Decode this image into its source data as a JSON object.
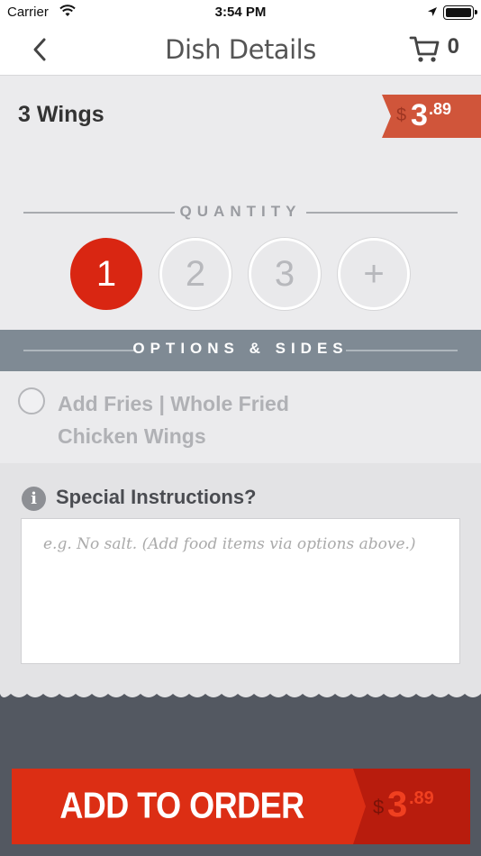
{
  "status_bar": {
    "carrier": "Carrier",
    "time": "3:54 PM"
  },
  "nav": {
    "title": "Dish Details",
    "cart_count": "0"
  },
  "dish": {
    "name": "3 Wings",
    "price_symbol": "$",
    "price_whole": "3",
    "price_cents": ".89"
  },
  "quantity": {
    "label": "QUANTITY",
    "options": [
      "1",
      "2",
      "3",
      "+"
    ],
    "selected": "1"
  },
  "options": {
    "label": "OPTIONS & SIDES",
    "items": [
      {
        "label": "Add Fries | Whole Fried Chicken Wings",
        "checked": false
      }
    ]
  },
  "instructions": {
    "heading": "Special Instructions?",
    "placeholder": "e.g. No salt. (Add food items via options above.)",
    "value": ""
  },
  "cta": {
    "label": "ADD TO ORDER",
    "price_symbol": "$",
    "price_whole": "3",
    "price_cents": ".89"
  },
  "colors": {
    "accent": "#dc2e14",
    "price_tag": "#d0553a",
    "options_bar": "#7f8a94",
    "footer": "#535861"
  }
}
